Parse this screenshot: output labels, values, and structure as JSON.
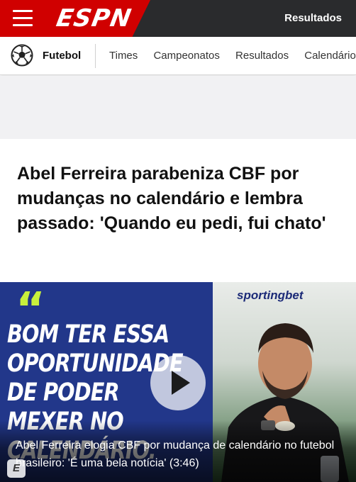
{
  "topbar": {
    "logo_text": "ESPN",
    "results_label": "Resultados"
  },
  "subnav": {
    "sport_label": "Futebol",
    "items": [
      "Times",
      "Campeonatos",
      "Resultados",
      "Calendário"
    ]
  },
  "article": {
    "headline": "Abel Ferreira parabeniza CBF por mudanças no calendário e lembra passado: 'Quando eu pedi, fui chato'"
  },
  "video": {
    "sponsor": "sportingbet",
    "quote_mark": "“",
    "quote_text": "BOM TER ESSA OPORTUNIDADE DE PODER MEXER NO CALENDÁRIO.",
    "caption": "Abel Ferreira elogia CBF por mudança de calendário no futebol brasileiro: 'É uma bela notícia' (3:46)",
    "badge": "E"
  },
  "colors": {
    "espn_red": "#d00000",
    "topbar_dark": "#2a2b2d",
    "quote_green": "#c8f03c",
    "video_blue": "#22378a"
  },
  "icons": [
    "menu-icon",
    "soccer-ball-icon",
    "play-icon"
  ]
}
